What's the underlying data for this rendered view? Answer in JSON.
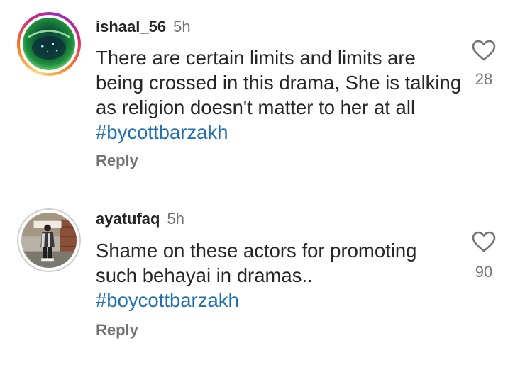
{
  "comments": [
    {
      "username": "ishaal_56",
      "time": "5h",
      "text_before": "There are certain limits and limits are being crossed in this drama, She is talking as religion doesn't matter to her at all ",
      "hashtag": "#bycottbarzakh",
      "reply_label": "Reply",
      "likes": "28",
      "heart_icon": "heart-outline-icon"
    },
    {
      "username": "ayatufaq",
      "time": "5h",
      "text_before": "Shame on these actors for promoting such behayai  in dramas.. ",
      "hashtag": "#boycottbarzakh",
      "reply_label": "Reply",
      "likes": "90",
      "heart_icon": "heart-outline-icon"
    }
  ],
  "colors": {
    "hashtag": "#1f6fb2",
    "secondary_text": "#737373",
    "primary_text": "#262626"
  }
}
